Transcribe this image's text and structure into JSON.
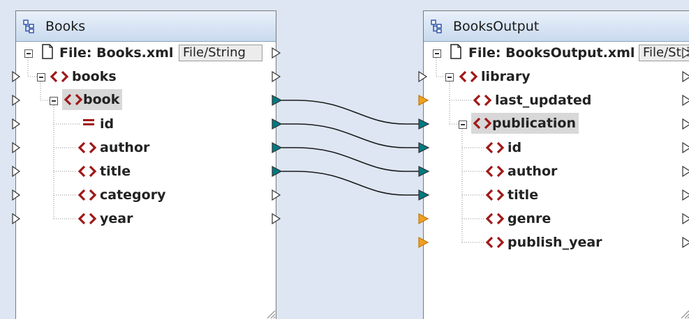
{
  "left_component": {
    "title": "Books",
    "file_label": "File: Books.xml",
    "file_button": "File/String",
    "items": {
      "root": "books",
      "book": "book",
      "id": "id",
      "author": "author",
      "title": "title",
      "category": "category",
      "year": "year"
    }
  },
  "right_component": {
    "title": "BooksOutput",
    "file_label": "File: BooksOutput.xml",
    "file_button": "File/String",
    "items": {
      "root": "library",
      "last_updated": "last_updated",
      "publication": "publication",
      "id": "id",
      "author": "author",
      "title": "title",
      "genre": "genre",
      "publish_year": "publish_year"
    }
  },
  "colors": {
    "element_icon": "#a01818",
    "connector_mapped": "#007a82",
    "connector_required": "#f0a020",
    "connector_empty": "#ffffff",
    "mapping_line": "#1a1a1a"
  },
  "icons": {
    "component": "component-icon",
    "file": "file-icon",
    "element": "element-icon",
    "attribute": "attribute-icon",
    "collapse": "collapse-icon",
    "connector": "connector-arrow-icon"
  },
  "mappings": [
    {
      "from": "book",
      "to": "publication"
    },
    {
      "from": "id",
      "to": "id"
    },
    {
      "from": "author",
      "to": "author"
    },
    {
      "from": "title",
      "to": "title"
    }
  ]
}
